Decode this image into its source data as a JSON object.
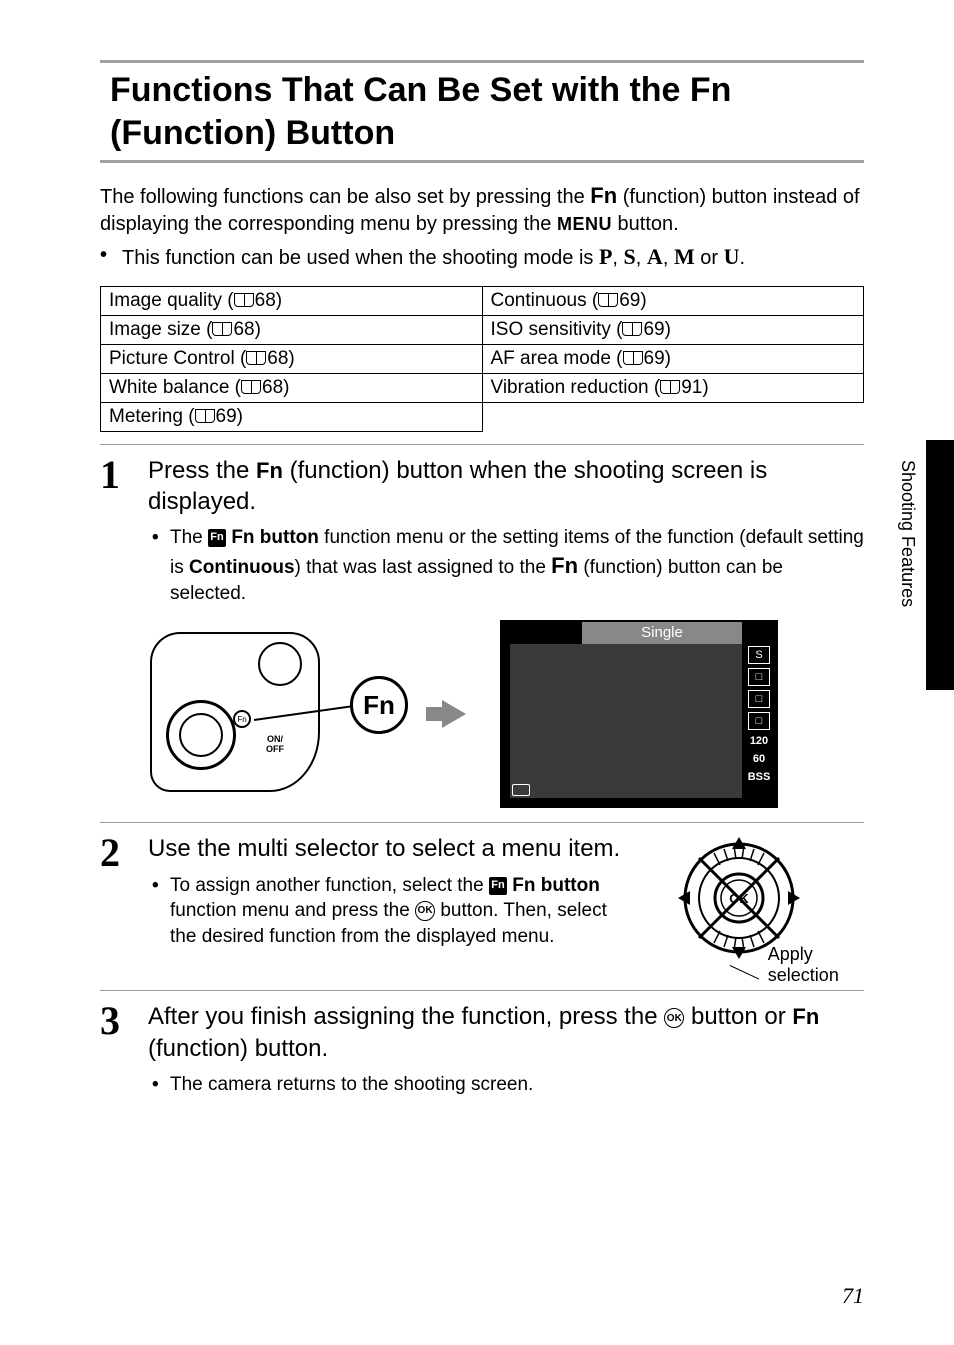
{
  "title": "Functions That Can Be Set with the Fn (Function) Button",
  "intro_line1_a": "The following functions can be also set by pressing the ",
  "intro_line1_b": " (function) button instead of displaying the corresponding menu by pressing the ",
  "intro_line1_c": " button.",
  "intro_bullet_a": "This function can be used when the shooting mode is ",
  "intro_bullet_b": " or ",
  "intro_bullet_c": ".",
  "modes": [
    "P",
    "S",
    "A",
    "M",
    "U"
  ],
  "glyphs": {
    "fn": "Fn",
    "menu": "MENU",
    "ok": "OK",
    "fn_btn": "Fn"
  },
  "functions_table": [
    {
      "left": {
        "name": "Image quality",
        "page": "68"
      },
      "right": {
        "name": "Continuous",
        "page": "69"
      }
    },
    {
      "left": {
        "name": "Image size",
        "page": "68"
      },
      "right": {
        "name": "ISO sensitivity",
        "page": "69"
      }
    },
    {
      "left": {
        "name": "Picture Control",
        "page": "68"
      },
      "right": {
        "name": "AF area mode",
        "page": "69"
      }
    },
    {
      "left": {
        "name": "White balance",
        "page": "68"
      },
      "right": {
        "name": "Vibration reduction",
        "page": "91"
      }
    },
    {
      "left": {
        "name": "Metering",
        "page": "69"
      },
      "right": null
    }
  ],
  "steps": {
    "s1": {
      "num": "1",
      "head_a": "Press the ",
      "head_b": " (function) button when the shooting screen is displayed.",
      "bullet_a": "The ",
      "bullet_b": "Fn button",
      "bullet_c": " function menu or the setting items of the function (default setting is ",
      "bullet_d": "Continuous",
      "bullet_e": ") that was last assigned to the ",
      "bullet_f": " (function) button can be selected."
    },
    "s2": {
      "num": "2",
      "head": "Use the multi selector to select a menu item.",
      "bullet_a": "To assign another function, select the ",
      "bullet_b": "Fn button",
      "bullet_c": " function menu and press the ",
      "bullet_d": " button. Then, select the desired function from the displayed menu.",
      "apply": "Apply selection"
    },
    "s3": {
      "num": "3",
      "head_a": "After you finish assigning the function, press the ",
      "head_b": " button or ",
      "head_c": " (function) button.",
      "bullet": "The camera returns to the shooting screen."
    }
  },
  "lcd": {
    "title": "Single",
    "side_icons": [
      "S",
      "□",
      "□",
      "□"
    ],
    "side_text": [
      "120",
      "60",
      "BSS"
    ]
  },
  "camera": {
    "onoff": "ON/\nOFF",
    "fn_small": "Fn",
    "fn_big": "Fn"
  },
  "side_label": "Shooting Features",
  "page_number": "71"
}
